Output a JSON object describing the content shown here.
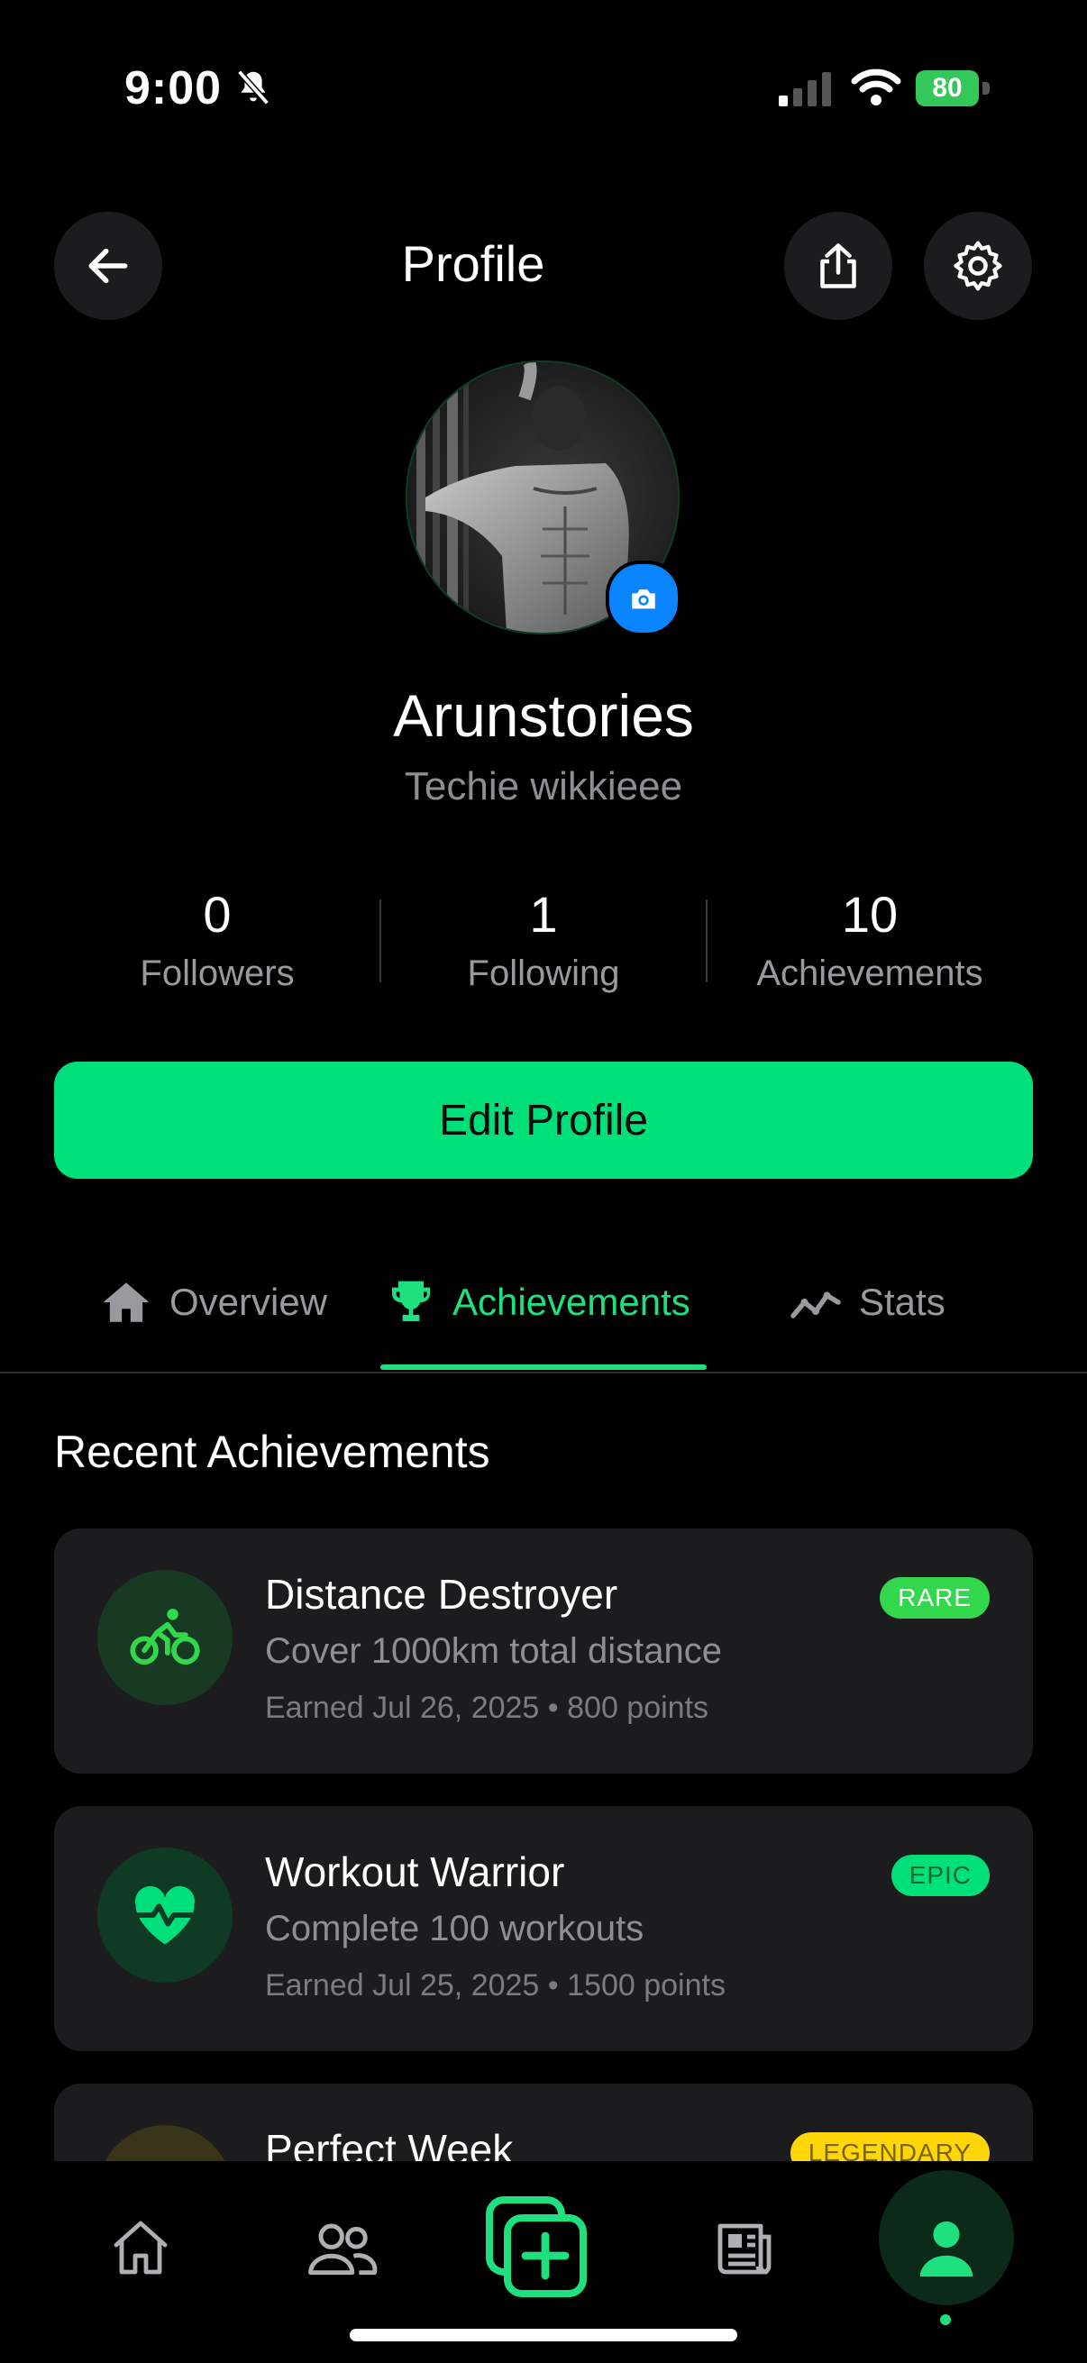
{
  "status_bar": {
    "time": "9:00",
    "battery": "80"
  },
  "header": {
    "title": "Profile"
  },
  "profile": {
    "username": "Arunstories",
    "bio": "Techie wikkieee"
  },
  "stats": [
    {
      "value": "0",
      "label": "Followers"
    },
    {
      "value": "1",
      "label": "Following"
    },
    {
      "value": "10",
      "label": "Achievements"
    }
  ],
  "edit_button": "Edit Profile",
  "tabs": [
    {
      "label": "Overview",
      "icon": "home-icon",
      "active": false
    },
    {
      "label": "Achievements",
      "icon": "trophy-icon",
      "active": true
    },
    {
      "label": "Stats",
      "icon": "trend-icon",
      "active": false
    }
  ],
  "section_title": "Recent Achievements",
  "achievements": [
    {
      "title": "Distance Destroyer",
      "description": "Cover 1000km total distance",
      "meta": "Earned Jul 26, 2025 • 800 points",
      "badge": "RARE",
      "icon": "bike-icon",
      "badge_color": "#32d74b",
      "icon_bg": "#183a22"
    },
    {
      "title": "Workout Warrior",
      "description": "Complete 100 workouts",
      "meta": "Earned Jul 25, 2025 • 1500 points",
      "badge": "EPIC",
      "icon": "heart-pulse-icon",
      "badge_color": "#00e07a",
      "icon_bg": "#0f3a24"
    },
    {
      "title": "Perfect Week",
      "badge": "LEGENDARY",
      "icon": "calendar-icon",
      "badge_color": "#ffd60a",
      "icon_bg": "#3a3418"
    }
  ],
  "bottom_nav": [
    "home-icon",
    "people-icon",
    "add-icon",
    "news-icon",
    "profile-icon"
  ],
  "colors": {
    "accent": "#00e07a",
    "background": "#000000",
    "card": "#1c1c1e"
  }
}
